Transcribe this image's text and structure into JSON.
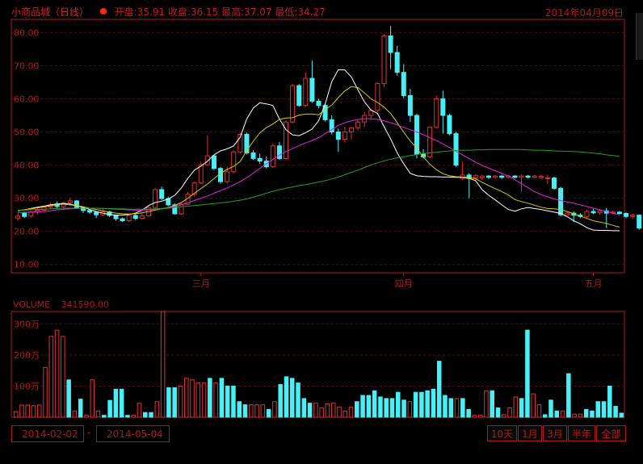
{
  "header": {
    "title": "小商品城（日线）",
    "open_label": "开盘:35.91",
    "close_label": "收盘:36.15",
    "high_label": "最高:37.07",
    "low_label": "最低:34.27",
    "date": "2014年04月09日"
  },
  "volume_header": {
    "label": "VOLUME",
    "value": "341590.00"
  },
  "range": {
    "start": "2014-02-02",
    "separator": "-",
    "end": "2014-05-04"
  },
  "buttons": {
    "d10": "10天",
    "m1": "1月",
    "m3": "3月",
    "half": "半年",
    "all": "全部"
  },
  "colors": {
    "up": "#e0322e",
    "down": "#46f0f6",
    "ma5": "#ffffff",
    "ma10": "#d8c800",
    "ma20": "#e020e0",
    "ma60": "#20a020",
    "frame": "#b01818",
    "grid": "#4a0e0e"
  },
  "chart_data": [
    {
      "type": "candlestick",
      "y_ticks": [
        "80.00",
        "70.00",
        "60.00",
        "50.00",
        "40.00",
        "30.00",
        "20.00",
        "10.00"
      ],
      "y_tick_values": [
        80,
        70,
        60,
        50,
        40,
        30,
        20,
        10
      ],
      "ylim": [
        7.5,
        84
      ],
      "x_ticks": [
        {
          "label": "三月",
          "index": 28
        },
        {
          "label": "四月",
          "index": 59
        },
        {
          "label": "五月",
          "index": 88
        }
      ],
      "n": 93,
      "series": [
        {
          "name": "MA5",
          "color": "#ffffff",
          "values": [
            26.2,
            26.5,
            26.9,
            27.3,
            27.6,
            28.0,
            28.3,
            28.4,
            28.2,
            27.8,
            27.2,
            26.6,
            26.0,
            25.5,
            25.1,
            24.9,
            24.9,
            25.1,
            25.5,
            26.4,
            27.8,
            28.7,
            29.1,
            29.8,
            30.9,
            33.1,
            36.0,
            38.5,
            39.7,
            41.2,
            43.1,
            44.3,
            44.9,
            45.8,
            48.4,
            53.9,
            57.2,
            58.8,
            58.5,
            58.0,
            53.9,
            50.7,
            49.1,
            48.9,
            49.8,
            50.9,
            53.4,
            58.5,
            65.2,
            68.8,
            68.7,
            66.6,
            62.7,
            59.1,
            56.6,
            55.6,
            51.6,
            47.9,
            43.7,
            40.4,
            37.5,
            36.8,
            36.6,
            36.5,
            36.5,
            36.4,
            36.4,
            36.3,
            36.3,
            36.0,
            35.3,
            32.6,
            30.9,
            29.5,
            28.0,
            26.6,
            26.1,
            26.8,
            27.2,
            26.9,
            26.6,
            26.2,
            25.8,
            25.4,
            24.4,
            23.2,
            22.3,
            21.1,
            20.4,
            20.3,
            20.3,
            20.2,
            20.2
          ]
        },
        {
          "name": "MA10",
          "color": "#d8c800",
          "values": [
            26.3,
            26.5,
            26.8,
            27.1,
            27.4,
            27.7,
            28.1,
            28.2,
            28.0,
            27.8,
            27.4,
            27.0,
            26.6,
            26.2,
            25.8,
            25.5,
            25.3,
            25.2,
            25.3,
            25.6,
            26.0,
            26.4,
            26.8,
            27.2,
            27.8,
            28.7,
            30.0,
            31.5,
            32.9,
            34.3,
            35.9,
            37.5,
            38.7,
            39.6,
            41.1,
            44.3,
            47.2,
            49.7,
            51.3,
            52.4,
            53.8,
            54.2,
            54.3,
            55.1,
            55.4,
            55.4,
            55.2,
            56.8,
            58.1,
            60.4,
            62.4,
            63.7,
            63.4,
            61.8,
            60.0,
            58.9,
            57.5,
            55.6,
            52.8,
            49.9,
            47.3,
            45.1,
            42.5,
            40.3,
            38.6,
            37.4,
            36.8,
            36.5,
            36.4,
            36.2,
            35.9,
            34.8,
            33.8,
            32.9,
            32.0,
            31.0,
            29.6,
            29.0,
            28.5,
            27.9,
            27.3,
            26.9,
            26.8,
            26.6,
            26.0,
            25.3,
            24.6,
            23.9,
            23.2,
            22.8,
            22.4,
            21.8,
            21.3
          ]
        },
        {
          "name": "MA20",
          "color": "#e020e0",
          "values": [
            25.6,
            25.7,
            25.8,
            25.9,
            26.0,
            26.2,
            26.5,
            26.7,
            26.8,
            26.9,
            27.0,
            27.0,
            27.0,
            26.9,
            26.8,
            26.7,
            26.6,
            26.5,
            26.4,
            26.4,
            26.5,
            26.6,
            26.8,
            27.1,
            27.5,
            28.0,
            28.6,
            29.3,
            30.0,
            30.7,
            31.5,
            32.3,
            33.1,
            34.0,
            35.0,
            36.2,
            37.6,
            39.0,
            40.4,
            41.7,
            43.0,
            44.1,
            45.0,
            45.9,
            46.7,
            47.4,
            48.3,
            49.5,
            50.7,
            52.0,
            52.8,
            53.4,
            53.8,
            54.0,
            54.0,
            53.8,
            53.4,
            52.8,
            52.1,
            51.4,
            50.7,
            50.0,
            49.2,
            48.3,
            47.4,
            46.4,
            45.3,
            44.2,
            43.1,
            42.0,
            40.9,
            39.9,
            39.1,
            38.3,
            37.5,
            36.7,
            35.6,
            34.4,
            33.2,
            32.0,
            31.1,
            30.4,
            29.8,
            29.3,
            28.9,
            28.5,
            28.0,
            27.5,
            27.0,
            26.5,
            26.0,
            25.5,
            25.0
          ]
        },
        {
          "name": "MA60",
          "color": "#20a020",
          "values": [
            26.3,
            26.4,
            26.5,
            26.6,
            26.7,
            26.8,
            26.9,
            27.0,
            27.0,
            27.0,
            27.0,
            27.0,
            27.0,
            26.9,
            26.9,
            26.8,
            26.8,
            26.7,
            26.7,
            26.7,
            26.7,
            26.8,
            26.9,
            27.0,
            27.2,
            27.4,
            27.6,
            27.8,
            28.0,
            28.2,
            28.4,
            28.6,
            28.8,
            29.1,
            29.4,
            29.8,
            30.3,
            30.9,
            31.5,
            32.1,
            32.6,
            33.0,
            33.4,
            33.8,
            34.1,
            34.5,
            34.9,
            35.3,
            35.8,
            36.4,
            37.1,
            37.8,
            38.5,
            39.3,
            40.0,
            40.7,
            41.3,
            41.8,
            42.2,
            42.5,
            42.9,
            43.2,
            43.5,
            43.7,
            43.9,
            44.1,
            44.3,
            44.4,
            44.5,
            44.5,
            44.6,
            44.6,
            44.7,
            44.7,
            44.7,
            44.7,
            44.7,
            44.7,
            44.6,
            44.5,
            44.5,
            44.4,
            44.3,
            44.2,
            44.2,
            44.1,
            44.0,
            43.8,
            43.6,
            43.4,
            43.1,
            42.9,
            42.6
          ]
        }
      ],
      "ohlc": [
        [
          24.0,
          24.6,
          23.2,
          25.4
        ],
        [
          25.5,
          24.5,
          24.0,
          26.0
        ],
        [
          24.6,
          25.9,
          24.2,
          26.2
        ],
        [
          26.0,
          26.4,
          25.2,
          27.0
        ],
        [
          26.4,
          27.3,
          25.9,
          27.6
        ],
        [
          27.3,
          28.0,
          26.7,
          28.5
        ],
        [
          28.0,
          27.5,
          27.0,
          29.0
        ],
        [
          27.5,
          28.6,
          27.0,
          29.0
        ],
        [
          28.6,
          29.2,
          28.3,
          30.0
        ],
        [
          29.2,
          27.2,
          27.0,
          29.4
        ],
        [
          27.2,
          26.3,
          25.5,
          27.5
        ],
        [
          26.3,
          25.8,
          25.2,
          26.6
        ],
        [
          25.8,
          25.0,
          24.0,
          26.0
        ],
        [
          25.0,
          25.9,
          24.6,
          27.0
        ],
        [
          25.9,
          24.8,
          24.3,
          26.2
        ],
        [
          24.8,
          23.8,
          23.2,
          25.0
        ],
        [
          23.8,
          23.2,
          22.8,
          24.2
        ],
        [
          23.2,
          24.8,
          22.8,
          25.0
        ],
        [
          24.8,
          23.9,
          23.4,
          25.3
        ],
        [
          23.9,
          24.7,
          23.6,
          25.7
        ],
        [
          24.7,
          27.2,
          24.4,
          27.6
        ],
        [
          27.2,
          32.6,
          27.0,
          33.0
        ],
        [
          32.6,
          29.9,
          29.5,
          33.5
        ],
        [
          29.9,
          28.0,
          27.6,
          30.5
        ],
        [
          28.0,
          25.3,
          25.0,
          28.5
        ],
        [
          25.3,
          28.2,
          25.0,
          28.5
        ],
        [
          28.2,
          31.2,
          28.0,
          32.0
        ],
        [
          31.2,
          34.6,
          30.5,
          35.0
        ],
        [
          34.6,
          40.1,
          34.2,
          41.0
        ],
        [
          40.1,
          42.8,
          39.8,
          49.0
        ],
        [
          42.8,
          39.0,
          38.5,
          43.0
        ],
        [
          39.0,
          35.0,
          34.4,
          39.5
        ],
        [
          35.0,
          38.0,
          34.5,
          39.6
        ],
        [
          38.0,
          44.0,
          37.5,
          44.5
        ],
        [
          44.0,
          49.3,
          43.5,
          49.8
        ],
        [
          49.3,
          43.7,
          43.2,
          49.8
        ],
        [
          43.7,
          42.0,
          41.6,
          44.5
        ],
        [
          42.0,
          41.2,
          40.4,
          43.5
        ],
        [
          41.2,
          39.5,
          39.0,
          42.6
        ],
        [
          39.5,
          45.8,
          39.3,
          46.5
        ],
        [
          45.8,
          42.0,
          41.6,
          47.0
        ],
        [
          42.0,
          53.0,
          41.6,
          53.5
        ],
        [
          53.0,
          64.0,
          52.5,
          64.5
        ],
        [
          64.0,
          58.0,
          57.6,
          64.5
        ],
        [
          58.0,
          66.2,
          57.6,
          68.0
        ],
        [
          66.2,
          59.3,
          58.8,
          71.5
        ],
        [
          59.3,
          58.0,
          57.2,
          60.0
        ],
        [
          58.0,
          53.7,
          53.2,
          58.5
        ],
        [
          53.7,
          50.0,
          49.3,
          55.0
        ],
        [
          50.0,
          47.8,
          44.0,
          51.0
        ],
        [
          47.8,
          50.0,
          46.8,
          51.5
        ],
        [
          50.0,
          51.3,
          47.6,
          51.5
        ],
        [
          51.3,
          53.0,
          50.5,
          53.6
        ],
        [
          53.0,
          55.0,
          51.5,
          56.0
        ],
        [
          55.0,
          56.5,
          53.5,
          57.0
        ],
        [
          56.5,
          64.6,
          56.0,
          65.0
        ],
        [
          64.6,
          79.0,
          63.5,
          79.5
        ],
        [
          79.0,
          74.0,
          69.0,
          82.0
        ],
        [
          74.0,
          68.0,
          67.0,
          76.0
        ],
        [
          68.0,
          61.0,
          60.2,
          70.5
        ],
        [
          61.0,
          55.0,
          53.0,
          63.0
        ],
        [
          55.0,
          43.3,
          42.0,
          55.5
        ],
        [
          43.3,
          42.5,
          42.0,
          44.8
        ],
        [
          42.5,
          51.4,
          42.0,
          51.8
        ],
        [
          51.4,
          60.0,
          51.0,
          61.0
        ],
        [
          60.0,
          55.0,
          49.5,
          62.5
        ],
        [
          55.0,
          49.5,
          49.0,
          55.5
        ],
        [
          49.5,
          40.0,
          39.5,
          50.0
        ],
        [
          36.0,
          37.0,
          35.5,
          41.0
        ],
        [
          37.0,
          36.0,
          30.0,
          37.5
        ],
        [
          36.2,
          36.8,
          35.5,
          37.2
        ],
        [
          36.2,
          36.7,
          35.5,
          37.1
        ],
        [
          36.7,
          36.3,
          35.8,
          37.0
        ],
        [
          36.3,
          36.7,
          35.9,
          37.0
        ],
        [
          36.7,
          36.3,
          35.8,
          37.1
        ],
        [
          36.3,
          36.7,
          36.0,
          37.0
        ],
        [
          36.7,
          36.3,
          36.0,
          37.0
        ],
        [
          36.3,
          36.7,
          32.0,
          37.2
        ],
        [
          36.7,
          36.3,
          36.0,
          37.0
        ],
        [
          36.3,
          36.7,
          36.0,
          37.0
        ],
        [
          36.2,
          36.6,
          36.0,
          37.0
        ],
        [
          35.91,
          36.15,
          34.27,
          37.07
        ],
        [
          36.1,
          33.0,
          32.6,
          36.5
        ],
        [
          33.0,
          25.0,
          24.5,
          33.5
        ],
        [
          25.0,
          25.5,
          24.8,
          26.0
        ],
        [
          25.5,
          24.9,
          22.8,
          26.0
        ],
        [
          24.9,
          24.5,
          24.0,
          25.5
        ],
        [
          24.5,
          26.0,
          24.0,
          26.5
        ],
        [
          26.0,
          25.6,
          25.2,
          26.8
        ],
        [
          25.6,
          26.2,
          25.0,
          26.8
        ],
        [
          26.2,
          25.5,
          21.0,
          27.0
        ],
        [
          25.5,
          25.8,
          25.1,
          26.3
        ],
        [
          25.8,
          25.4,
          25.0,
          26.1
        ],
        [
          25.4,
          24.5,
          24.0,
          25.8
        ],
        [
          24.5,
          24.9,
          23.8,
          25.3
        ],
        [
          24.9,
          21.0,
          20.5,
          25.0
        ],
        [
          21.0,
          19.8,
          19.5,
          21.5
        ],
        [
          19.8,
          20.0,
          19.6,
          20.4
        ],
        [
          20.0,
          19.8,
          19.5,
          20.2
        ]
      ]
    },
    {
      "type": "bar",
      "y_ticks": [
        "300万",
        "200万",
        "100万"
      ],
      "y_tick_values": [
        3000000,
        2000000,
        1000000
      ],
      "ylim": [
        0,
        3400000
      ],
      "values": [
        180000,
        390000,
        390000,
        370000,
        390000,
        1600000,
        2600000,
        2800000,
        2600000,
        1200000,
        200000,
        580000,
        60000,
        1200000,
        200000,
        60000,
        540000,
        900000,
        900000,
        60000,
        60000,
        450000,
        150000,
        150000,
        500000,
        3400000,
        950000,
        950000,
        1000000,
        1250000,
        1200000,
        1100000,
        1100000,
        1250000,
        1100000,
        1250000,
        1000000,
        1000000,
        500000,
        400000,
        400000,
        400000,
        400000,
        250000,
        500000,
        1050000,
        1300000,
        1250000,
        1100000,
        600000,
        450000,
        450000,
        300000,
        430000,
        450000,
        330000,
        200000,
        320000,
        500000,
        700000,
        700000,
        850000,
        650000,
        600000,
        600000,
        800000,
        550000,
        500000,
        800000,
        800000,
        850000,
        900000,
        1800000,
        700000,
        600000,
        600000,
        600000,
        250000,
        60000,
        60000,
        850000,
        850000,
        300000,
        80000,
        300000,
        650000,
        600000,
        2800000,
        750000,
        400000,
        80000,
        550000,
        200000,
        200000,
        1400000,
        100000,
        100000,
        250000,
        200000,
        500000,
        500000,
        1000000,
        350000,
        130000
      ],
      "up": [
        1,
        1,
        1,
        1,
        1,
        1,
        1,
        1,
        1,
        0,
        1,
        0,
        1,
        1,
        1,
        0,
        0,
        0,
        0,
        0,
        1,
        1,
        0,
        0,
        1,
        1,
        0,
        0,
        1,
        1,
        1,
        1,
        1,
        0,
        1,
        0,
        0,
        0,
        0,
        0,
        1,
        1,
        1,
        0,
        1,
        0,
        0,
        0,
        0,
        0,
        0,
        1,
        1,
        1,
        1,
        1,
        1,
        1,
        0,
        0,
        0,
        0,
        0,
        0,
        0,
        0,
        0,
        1,
        0,
        0,
        0,
        0,
        0,
        0,
        0,
        1,
        0,
        0,
        1,
        1,
        1,
        0,
        0,
        1,
        1,
        1,
        0,
        0,
        1,
        1,
        0,
        0,
        0,
        1,
        0,
        1,
        1,
        0,
        0,
        0,
        0,
        0,
        0,
        0,
        0
      ]
    }
  ]
}
